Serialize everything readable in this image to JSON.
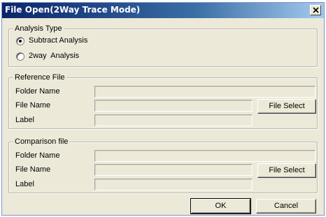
{
  "window": {
    "title": "File Open(2Way Trace Mode)"
  },
  "analysis_type": {
    "legend": "Analysis Type",
    "options": [
      {
        "label": "Subtract Analysis",
        "selected": true
      },
      {
        "label": "2way  Analysis",
        "selected": false
      }
    ]
  },
  "reference_file": {
    "legend": "Reference File",
    "folder_name_label": "Folder Name",
    "file_name_label": "File Name",
    "label_label": "Label",
    "folder_name_value": "",
    "file_name_value": "",
    "label_value": "",
    "file_select_label": "File Select"
  },
  "comparison_file": {
    "legend": "Comparison file",
    "folder_name_label": "Folder Name",
    "file_name_label": "File Name",
    "label_label": "Label",
    "folder_name_value": "",
    "file_name_value": "",
    "label_value": "",
    "file_select_label": "File Select"
  },
  "footer": {
    "ok_label": "OK",
    "cancel_label": "Cancel"
  },
  "colors": {
    "titlebar_start": "#0a246a",
    "titlebar_end": "#a6caf0",
    "dialog_bg": "#ece9d8"
  },
  "icons": {
    "close": "close-x-icon"
  }
}
